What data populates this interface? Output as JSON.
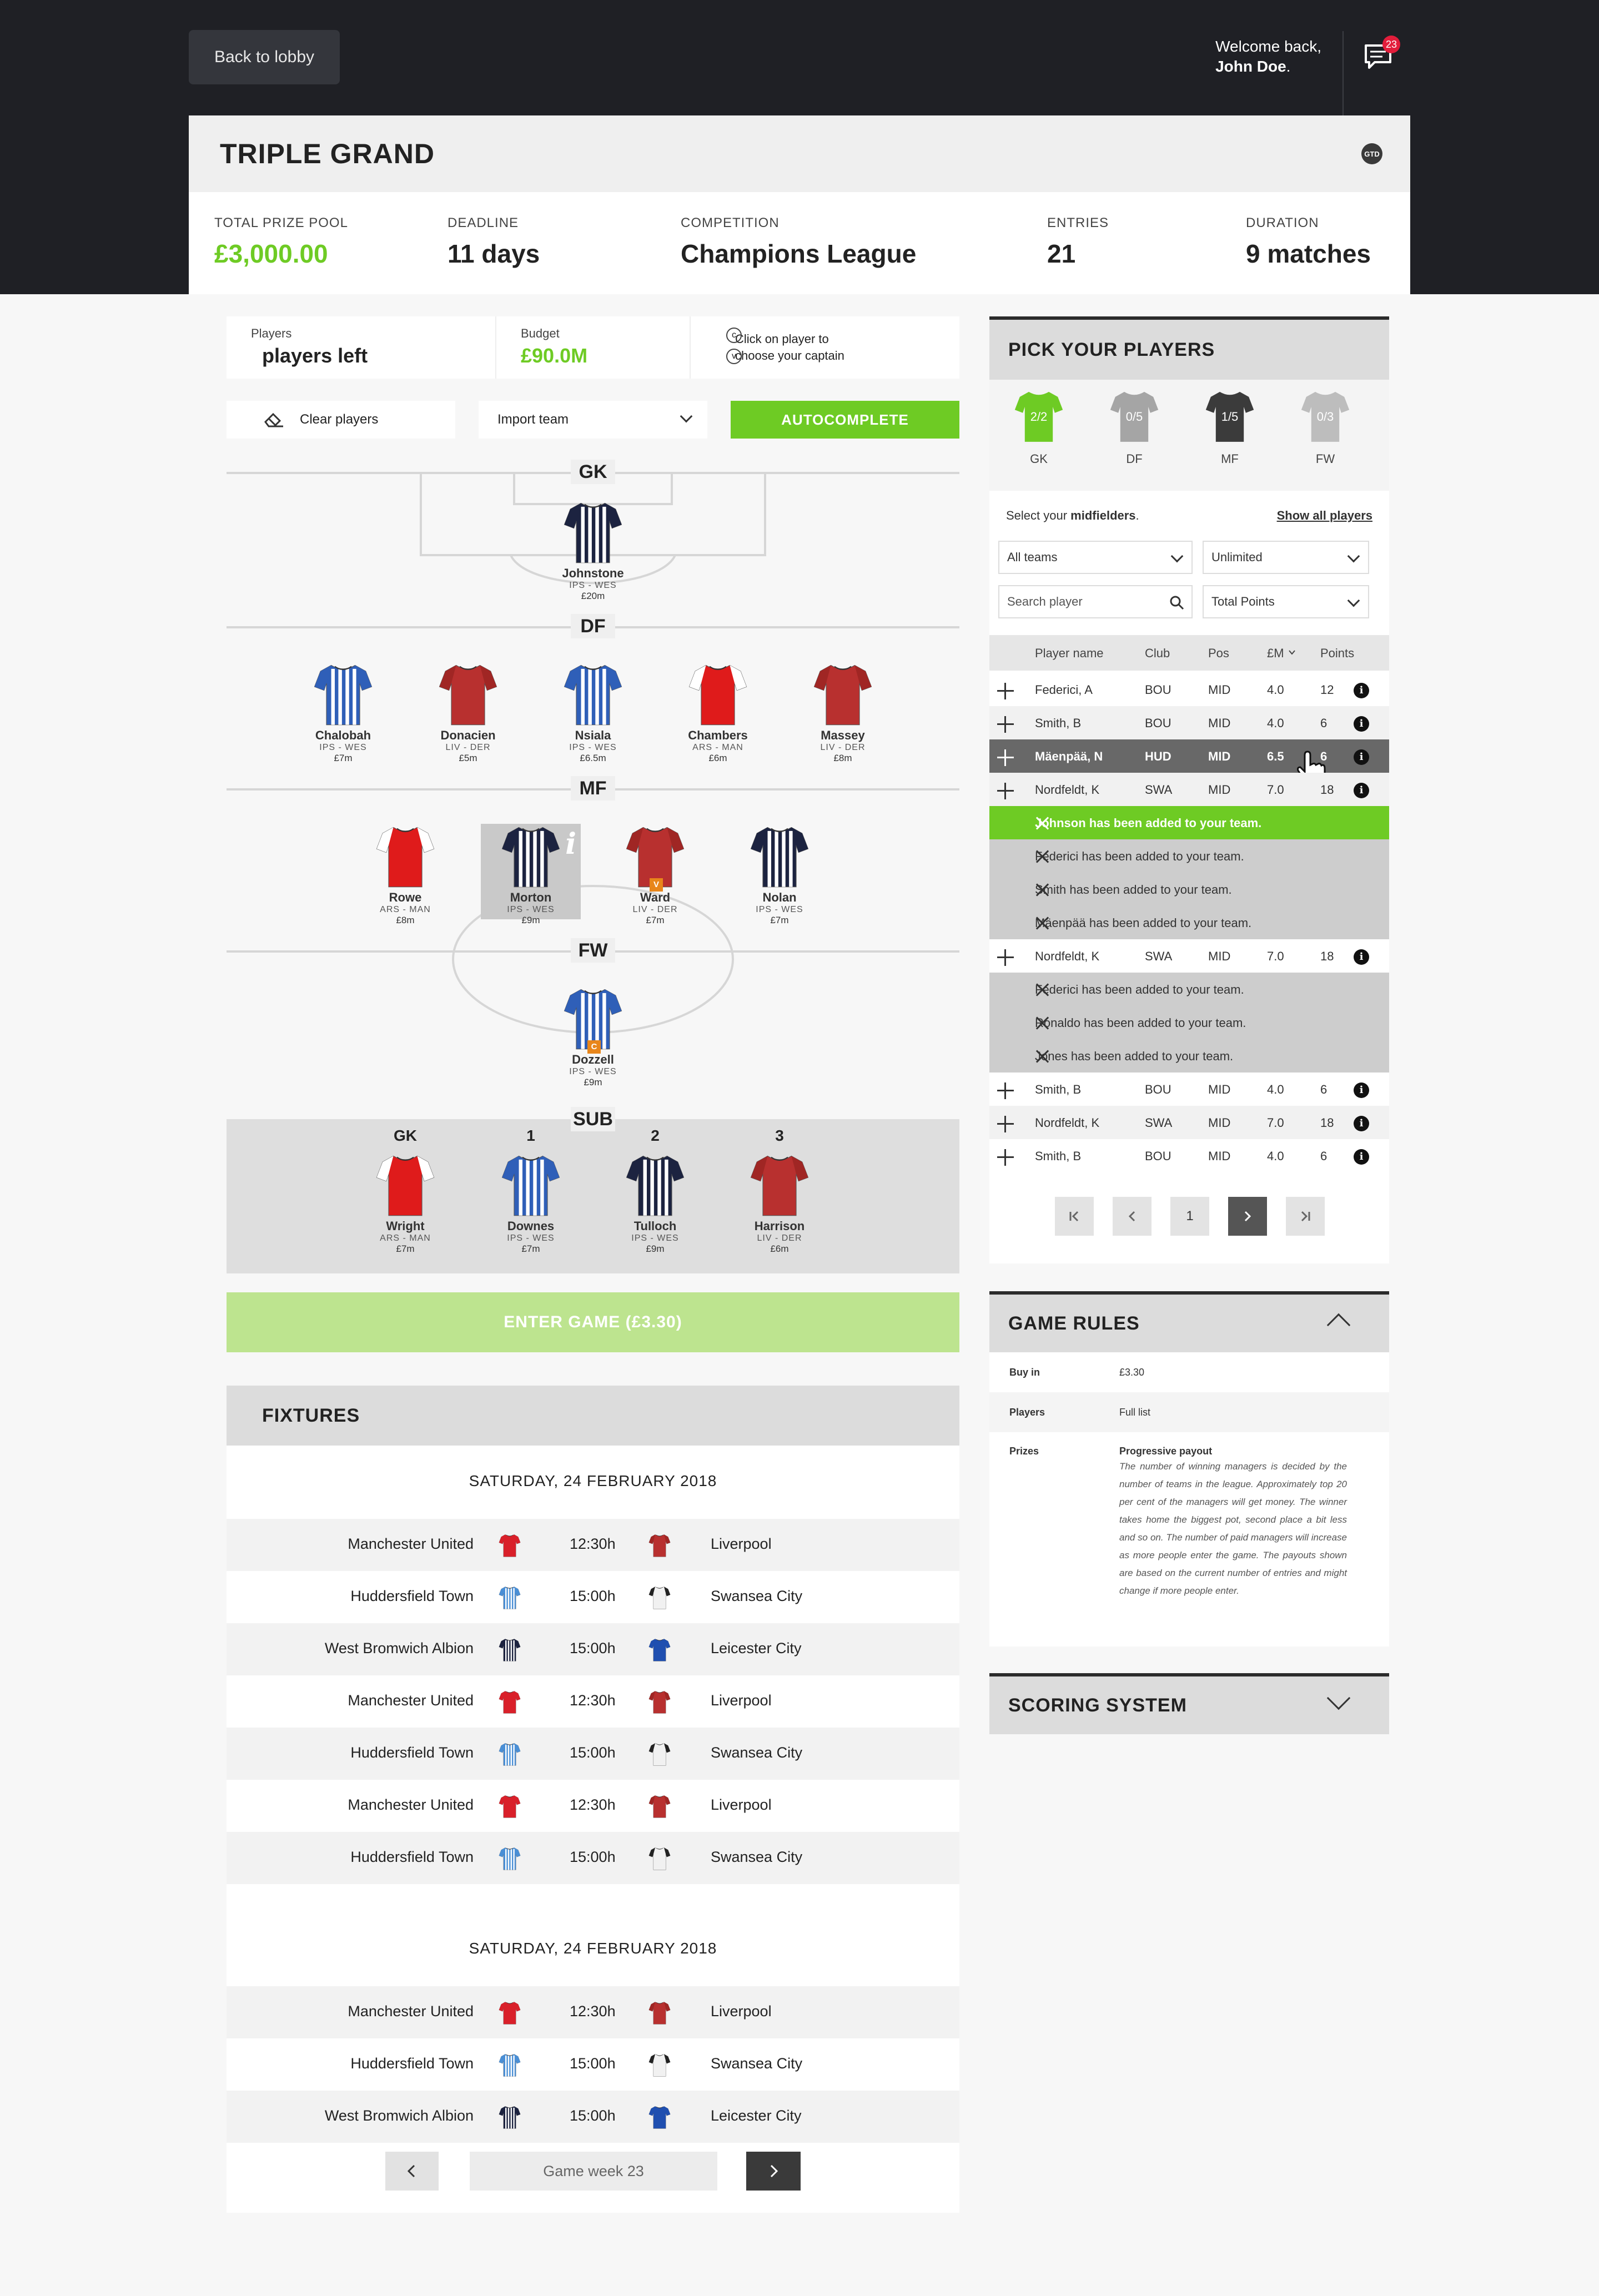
{
  "header": {
    "back_label": "Back to lobby",
    "welcome_line": "Welcome back,",
    "user_name": "John Doe",
    "notification_count": "23"
  },
  "contest": {
    "title": "TRIPLE GRAND",
    "badge": "GTD",
    "stats": [
      {
        "label": "TOTAL PRIZE POOL",
        "value": "£3,000.00"
      },
      {
        "label": "DEADLINE",
        "value": "11 days"
      },
      {
        "label": "COMPETITION",
        "value": "Champions League"
      },
      {
        "label": "ENTRIES",
        "value": "21"
      },
      {
        "label": "DURATION",
        "value": "9 matches"
      }
    ]
  },
  "team_info": {
    "players_label": "Players",
    "players_value": "players left",
    "budget_label": "Budget",
    "budget_value": "£90.0M",
    "captain_hint_1": "Click on player to",
    "captain_hint_2": "choose your captain",
    "captain_c": "c",
    "captain_v": "v"
  },
  "actions": {
    "clear": "Clear players",
    "import": "Import team",
    "autocomplete": "AUTOCOMPLETE"
  },
  "pitch": {
    "positions": [
      "GK",
      "DF",
      "MF",
      "FW",
      "SUB"
    ],
    "gk": [
      {
        "name": "Johnstone",
        "club": "IPS - WES",
        "price": "£20m",
        "kit": "navy"
      }
    ],
    "df": [
      {
        "name": "Chalobah",
        "club": "IPS - WES",
        "price": "£7m",
        "kit": "blue"
      },
      {
        "name": "Donacien",
        "club": "LIV - DER",
        "price": "£5m",
        "kit": "red"
      },
      {
        "name": "Nsiala",
        "club": "IPS - WES",
        "price": "£6.5m",
        "kit": "blue"
      },
      {
        "name": "Chambers",
        "club": "ARS - MAN",
        "price": "£6m",
        "kit": "arsenal"
      },
      {
        "name": "Massey",
        "club": "LIV - DER",
        "price": "£8m",
        "kit": "red"
      }
    ],
    "mf": [
      {
        "name": "Rowe",
        "club": "ARS - MAN",
        "price": "£8m",
        "kit": "arsenal"
      },
      {
        "name": "Morton",
        "club": "IPS - WES",
        "price": "£9m",
        "kit": "navy"
      },
      {
        "name": "Ward",
        "club": "LIV - DER",
        "price": "£7m",
        "kit": "red",
        "tag": "V"
      },
      {
        "name": "Nolan",
        "club": "IPS - WES",
        "price": "£7m",
        "kit": "navy"
      }
    ],
    "fw": [
      {
        "name": "Dozzell",
        "club": "IPS - WES",
        "price": "£9m",
        "kit": "blue",
        "tag": "C"
      }
    ],
    "sub_labels": [
      "GK",
      "1",
      "2",
      "3"
    ],
    "subs": [
      {
        "name": "Wright",
        "club": "ARS - MAN",
        "price": "£7m",
        "kit": "arsenal"
      },
      {
        "name": "Downes",
        "club": "IPS - WES",
        "price": "£7m",
        "kit": "blue"
      },
      {
        "name": "Tulloch",
        "club": "IPS - WES",
        "price": "£9m",
        "kit": "navy"
      },
      {
        "name": "Harrison",
        "club": "LIV - DER",
        "price": "£6m",
        "kit": "red"
      }
    ],
    "info_glyph": "i"
  },
  "enter_label": "ENTER GAME (£3.30)",
  "fixtures": {
    "title": "FIXTURES",
    "groups": [
      {
        "date": "SATURDAY, 24 FEBRUARY 2018",
        "matches": [
          {
            "home": "Manchester United",
            "time": "12:30h",
            "away": "Liverpool",
            "hk": "manu",
            "ak": "red"
          },
          {
            "home": "Huddersfield Town",
            "time": "15:00h",
            "away": "Swansea City",
            "hk": "hud",
            "ak": "white"
          },
          {
            "home": "West Bromwich Albion",
            "time": "15:00h",
            "away": "Leicester City",
            "hk": "navy",
            "ak": "bluek"
          },
          {
            "home": "Manchester United",
            "time": "12:30h",
            "away": "Liverpool",
            "hk": "manu",
            "ak": "red"
          },
          {
            "home": "Huddersfield Town",
            "time": "15:00h",
            "away": "Swansea City",
            "hk": "hud",
            "ak": "white"
          },
          {
            "home": "Manchester United",
            "time": "12:30h",
            "away": "Liverpool",
            "hk": "manu",
            "ak": "red"
          },
          {
            "home": "Huddersfield Town",
            "time": "15:00h",
            "away": "Swansea City",
            "hk": "hud",
            "ak": "white"
          }
        ]
      },
      {
        "date": "SATURDAY, 24 FEBRUARY 2018",
        "matches": [
          {
            "home": "Manchester United",
            "time": "12:30h",
            "away": "Liverpool",
            "hk": "manu",
            "ak": "red"
          },
          {
            "home": "Huddersfield Town",
            "time": "15:00h",
            "away": "Swansea City",
            "hk": "hud",
            "ak": "white"
          },
          {
            "home": "West Bromwich Albion",
            "time": "15:00h",
            "away": "Leicester City",
            "hk": "navy",
            "ak": "bluek"
          }
        ]
      }
    ],
    "gameweek": "Game week 23"
  },
  "pick": {
    "title": "PICK YOUR PLAYERS",
    "tabs": [
      {
        "count": "2/2",
        "label": "GK",
        "color": "#6ecb24"
      },
      {
        "count": "0/5",
        "label": "DF",
        "color": "#a5a5a5"
      },
      {
        "count": "1/5",
        "label": "MF",
        "color": "#3b3b3b"
      },
      {
        "count": "0/3",
        "label": "FW",
        "color": "#bdbdbd"
      }
    ],
    "select_prefix": "Select your ",
    "select_bold": "midfielders",
    "select_suffix": ".",
    "show_all": "Show all players",
    "team_filter": "All teams",
    "budget_filter": "Unlimited",
    "search_placeholder": "Search player",
    "sort_filter": "Total Points",
    "columns": [
      "Player name",
      "Club",
      "Pos",
      "£M",
      "Points"
    ],
    "rows": [
      {
        "type": "player",
        "name": "Federici, A",
        "club": "BOU",
        "pos": "MID",
        "price": "4.0",
        "points": "12"
      },
      {
        "type": "player",
        "name": "Smith, B",
        "club": "BOU",
        "pos": "MID",
        "price": "4.0",
        "points": "6"
      },
      {
        "type": "player",
        "name": "Mäenpää, N",
        "club": "HUD",
        "pos": "MID",
        "price": "6.5",
        "points": "6",
        "selected": true
      },
      {
        "type": "player",
        "name": "Nordfeldt, K",
        "club": "SWA",
        "pos": "MID",
        "price": "7.0",
        "points": "18"
      },
      {
        "type": "note",
        "text": "Johnson has been added to your team.",
        "ok": true
      },
      {
        "type": "note",
        "text": "Federici has been added to your team."
      },
      {
        "type": "note",
        "text": "Smith has been added to your team."
      },
      {
        "type": "note",
        "text": "Mäenpää has been added to your team."
      },
      {
        "type": "player",
        "name": "Nordfeldt, K",
        "club": "SWA",
        "pos": "MID",
        "price": "7.0",
        "points": "18"
      },
      {
        "type": "note",
        "text": "Federici has been added to your team."
      },
      {
        "type": "note",
        "text": "Ronaldo has been added to your team."
      },
      {
        "type": "note",
        "text": "Jones has been added to your team."
      },
      {
        "type": "player",
        "name": "Smith, B",
        "club": "BOU",
        "pos": "MID",
        "price": "4.0",
        "points": "6"
      },
      {
        "type": "player",
        "name": "Nordfeldt, K",
        "club": "SWA",
        "pos": "MID",
        "price": "7.0",
        "points": "18"
      },
      {
        "type": "player",
        "name": "Smith, B",
        "club": "BOU",
        "pos": "MID",
        "price": "4.0",
        "points": "6"
      }
    ],
    "page": "1"
  },
  "rules": {
    "title": "GAME RULES",
    "buyin_label": "Buy in",
    "buyin_value": "£3.30",
    "players_label": "Players",
    "players_value": "Full list",
    "prizes_label": "Prizes",
    "prizes_value": "Progressive payout",
    "prizes_text": "The number of winning managers is decided by the number of teams in the league. Approximately top 20 per cent of the managers will get money. The winner takes home the biggest pot, second place a bit less and so on. The number of paid managers will increase as more people enter the game. The payouts shown are based on the current number of entries and might change if more people enter."
  },
  "scoring": {
    "title": "SCORING SYSTEM"
  }
}
